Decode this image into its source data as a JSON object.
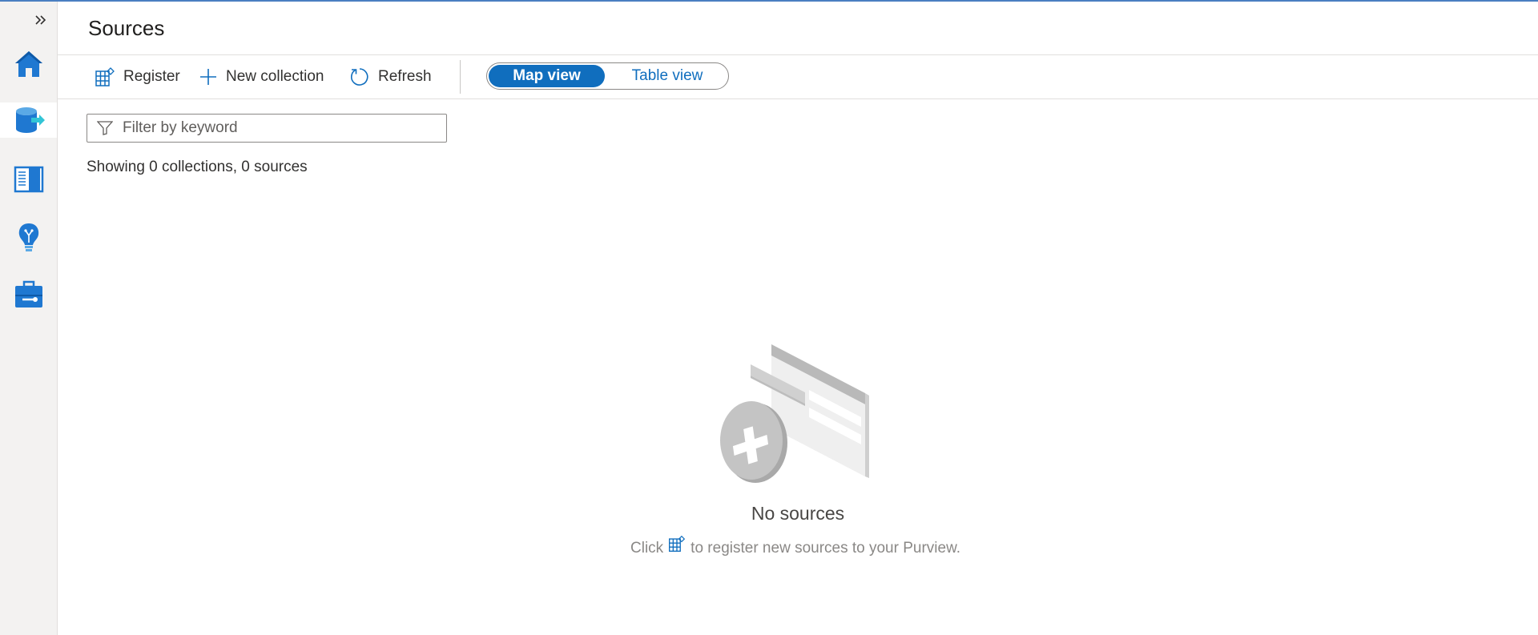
{
  "header": {
    "title": "Sources"
  },
  "rail": {
    "items": [
      {
        "icon": "home-icon"
      },
      {
        "icon": "data-map-icon"
      },
      {
        "icon": "catalog-icon"
      },
      {
        "icon": "insights-icon"
      },
      {
        "icon": "management-icon"
      }
    ]
  },
  "toolbar": {
    "register_label": "Register",
    "new_collection_label": "New collection",
    "refresh_label": "Refresh",
    "view_toggle": {
      "map_view_label": "Map view",
      "table_view_label": "Table view",
      "selected": "Map view"
    }
  },
  "filter": {
    "placeholder": "Filter by keyword",
    "value": ""
  },
  "summary": {
    "text": "Showing 0 collections, 0 sources"
  },
  "empty_state": {
    "title": "No sources",
    "hint_before": "Click",
    "hint_after": "to register new sources to your Purview."
  },
  "colors": {
    "accent": "#106ebe",
    "rail_bg": "#f3f2f1",
    "icon_blue": "#1f78d1"
  }
}
